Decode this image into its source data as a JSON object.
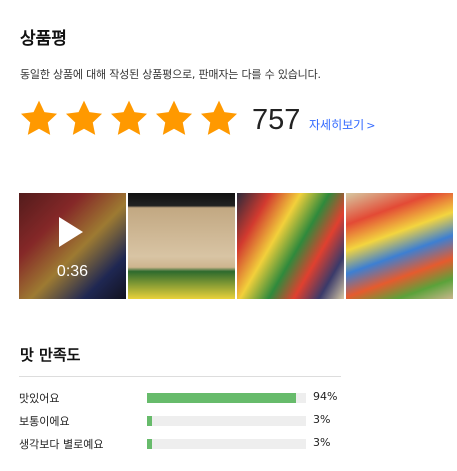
{
  "review": {
    "title": "상품평",
    "description": "동일한 상품에 대해 작성된 상품평으로, 판매자는 다를 수 있습니다.",
    "rating": 5,
    "rating_max": 5,
    "star_color": "#ff9900",
    "count": "757",
    "detail_link": "자세히보기",
    "detail_arrow": ">",
    "link_color": "#346aff"
  },
  "media": {
    "video_duration": "0:36",
    "thumbnails": [
      {
        "kind": "video",
        "icon": "play-icon"
      },
      {
        "kind": "photo"
      },
      {
        "kind": "photo"
      },
      {
        "kind": "photo"
      }
    ]
  },
  "taste": {
    "title": "맛 만족도",
    "bar_color": "#67bb6b",
    "rows": [
      {
        "label": "맛있어요",
        "percent": 94,
        "percent_label": "94%"
      },
      {
        "label": "보통이에요",
        "percent": 3,
        "percent_label": "3%"
      },
      {
        "label": "생각보다 별로예요",
        "percent": 3,
        "percent_label": "3%"
      }
    ]
  }
}
